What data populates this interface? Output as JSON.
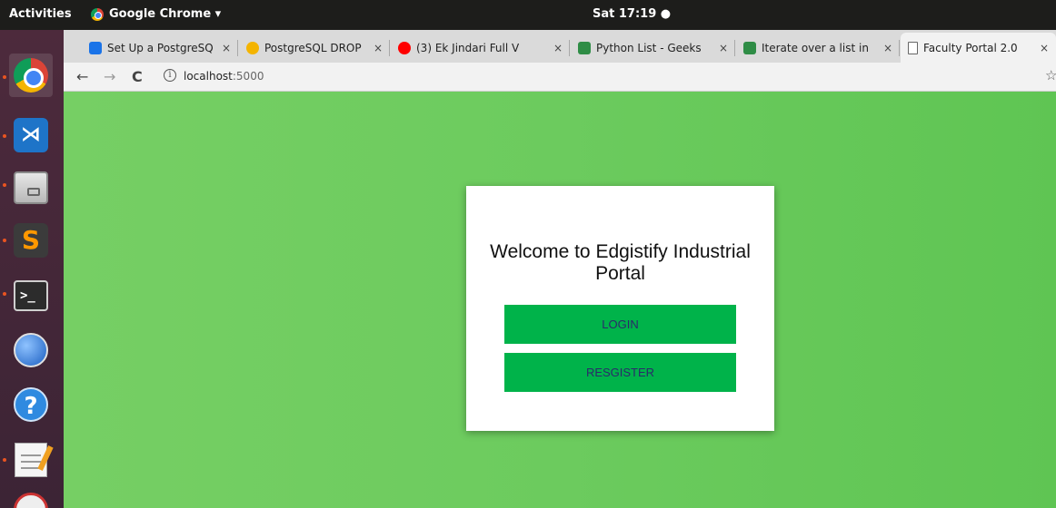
{
  "topbar": {
    "activities": "Activities",
    "app_menu": "Google Chrome ▾",
    "clock": "Sat 17:19 ●"
  },
  "dock": {
    "items": [
      {
        "name": "chrome-icon"
      },
      {
        "name": "vscode-icon"
      },
      {
        "name": "files-icon"
      },
      {
        "name": "sublime-icon"
      },
      {
        "name": "terminal-icon"
      },
      {
        "name": "thunderbird-icon"
      },
      {
        "name": "help-icon"
      },
      {
        "name": "text-editor-icon"
      }
    ]
  },
  "browser": {
    "tabs": [
      {
        "title": "Set Up a PostgreSQ",
        "favicon_color": "#1a73e8",
        "close": "×"
      },
      {
        "title": "PostgreSQL DROP",
        "favicon_color": "#f4b400",
        "close": "×"
      },
      {
        "title": "(3) Ek Jindari Full V",
        "favicon_color": "#ff0000",
        "close": "×"
      },
      {
        "title": "Python List - Geeks",
        "favicon_color": "#2f8d46",
        "close": "×"
      },
      {
        "title": "Iterate over a list in",
        "favicon_color": "#2f8d46",
        "close": "×"
      },
      {
        "title": "Faculty Portal 2.0",
        "favicon_color": "#ffffff",
        "close": "×"
      }
    ],
    "nav": {
      "back": "←",
      "forward": "→",
      "reload": "C"
    },
    "url": {
      "host": "localhost",
      "port": ":5000"
    }
  },
  "page": {
    "heading": "Welcome to Edgistify Industrial Portal",
    "login_label": "LOGIN",
    "register_label": "RESGISTER",
    "accent": "#00b34a",
    "background": "#6ccb5e"
  }
}
